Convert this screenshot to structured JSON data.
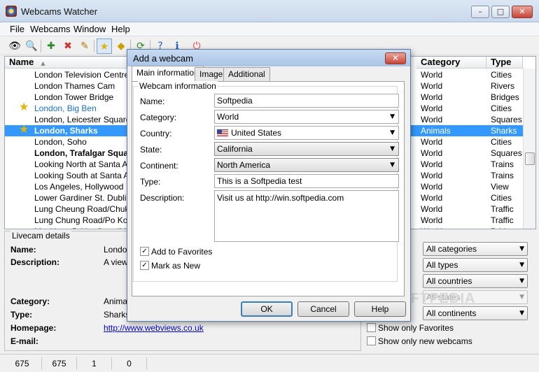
{
  "window": {
    "title": "Webcams Watcher",
    "min": "–",
    "max": "□",
    "close": "✕"
  },
  "menu": [
    "File",
    "Webcams",
    "Window",
    "Help"
  ],
  "list": {
    "headers": {
      "name": "Name",
      "category": "Category",
      "type": "Type"
    },
    "rows": [
      {
        "name": "London Television Centre C",
        "category": "World",
        "type": "Cities"
      },
      {
        "name": "London Thames Cam",
        "category": "World",
        "type": "Rivers"
      },
      {
        "name": "London Tower Bridge",
        "category": "World",
        "type": "Bridges"
      },
      {
        "name": "London, Big Ben",
        "category": "World",
        "type": "Cities"
      },
      {
        "name": "London, Leicester Square",
        "category": "World",
        "type": "Squares"
      },
      {
        "name": "London, Sharks",
        "category": "Animals",
        "type": "Sharks"
      },
      {
        "name": "London, Soho",
        "category": "World",
        "type": "Cities"
      },
      {
        "name": "London, Trafalgar Squa",
        "category": "World",
        "type": "Squares"
      },
      {
        "name": "Looking North at Santa Ana",
        "category": "World",
        "type": "Trains"
      },
      {
        "name": "Looking South at Santa Ana",
        "category": "World",
        "type": "Trains"
      },
      {
        "name": "Los Angeles, Hollywood",
        "category": "World",
        "type": "View"
      },
      {
        "name": "Lower Gardiner St. Dublin, Ir",
        "category": "World",
        "type": "Cities"
      },
      {
        "name": "Lung Cheung Road/Chuk Y",
        "category": "World",
        "type": "Traffic"
      },
      {
        "name": "Lung Chung Road/Po Kong",
        "category": "World",
        "type": "Traffic"
      },
      {
        "name": "Mackinac BridgeCam (Mack",
        "category": "World",
        "type": "Bridges"
      }
    ]
  },
  "details": {
    "legend": "Livecam details",
    "name_label": "Name:",
    "name_value": "London",
    "desc_label": "Description:",
    "desc_value": "A view",
    "category_label": "Category:",
    "category_value": "Animals",
    "type_label": "Type:",
    "type_value": "Sharks",
    "homepage_label": "Homepage:",
    "homepage_value": "http://www.webviews.co.uk",
    "email_label": "E-mail:"
  },
  "filters": {
    "categories": "All categories",
    "types": "All types",
    "countries": "All countries",
    "states": "All states",
    "continents": "All continents",
    "show_favorites": "Show only Favorites",
    "show_new": "Show only new webcams"
  },
  "status": [
    "675",
    "675",
    "1",
    "0"
  ],
  "dialog": {
    "title": "Add a webcam",
    "tabs": [
      "Main information",
      "Image",
      "Additional"
    ],
    "legend": "Webcam information",
    "labels": {
      "name": "Name:",
      "category": "Category:",
      "country": "Country:",
      "state": "State:",
      "continent": "Continent:",
      "type": "Type:",
      "description": "Description:"
    },
    "values": {
      "name": "Softpedia",
      "category": "World",
      "country": "United States",
      "state": "California",
      "continent": "North America",
      "type": "This is a Softpedia test",
      "description": "Visit us at http://win.softpedia.com"
    },
    "add_favorites": "Add to Favorites",
    "mark_new": "Mark as New",
    "ok": "OK",
    "cancel": "Cancel",
    "help": "Help"
  },
  "watermark": "SOFTPEDIA",
  "colors": {
    "selection": "#3399ff",
    "star": "#e0b400",
    "link": "#1a6fd1"
  }
}
